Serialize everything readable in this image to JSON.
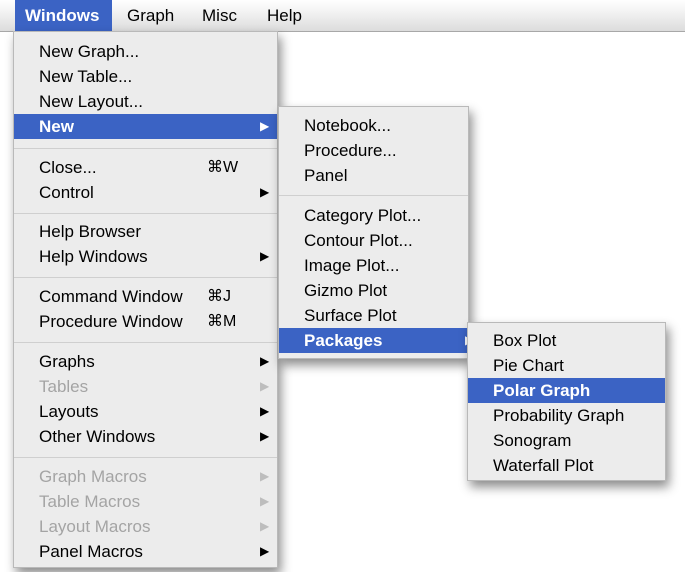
{
  "menubar": {
    "items": [
      "Windows",
      "Graph",
      "Misc",
      "Help"
    ]
  },
  "windows_menu": {
    "new_graph": "New Graph...",
    "new_table": "New Table...",
    "new_layout": "New Layout...",
    "new": "New",
    "close": "Close...",
    "close_shortcut": "⌘W",
    "control": "Control",
    "help_browser": "Help Browser",
    "help_windows": "Help Windows",
    "command_window": "Command Window",
    "command_window_shortcut": "⌘J",
    "procedure_window": "Procedure Window",
    "procedure_window_shortcut": "⌘M",
    "graphs": "Graphs",
    "tables": "Tables",
    "layouts": "Layouts",
    "other_windows": "Other Windows",
    "graph_macros": "Graph Macros",
    "table_macros": "Table Macros",
    "layout_macros": "Layout Macros",
    "panel_macros": "Panel Macros"
  },
  "new_submenu": {
    "notebook": "Notebook...",
    "procedure": "Procedure...",
    "panel": "Panel",
    "category_plot": "Category Plot...",
    "contour_plot": "Contour Plot...",
    "image_plot": "Image Plot...",
    "gizmo_plot": "Gizmo Plot",
    "surface_plot": "Surface Plot",
    "packages": "Packages"
  },
  "packages_submenu": {
    "box_plot": "Box Plot",
    "pie_chart": "Pie Chart",
    "polar_graph": "Polar Graph",
    "probability_graph": "Probability Graph",
    "sonogram": "Sonogram",
    "waterfall_plot": "Waterfall Plot"
  },
  "icons": {
    "submenu_arrow": "▶"
  },
  "colors": {
    "highlight": "#3b63c4",
    "menu_background": "#ececec",
    "disabled_text": "#a4a4a4"
  }
}
